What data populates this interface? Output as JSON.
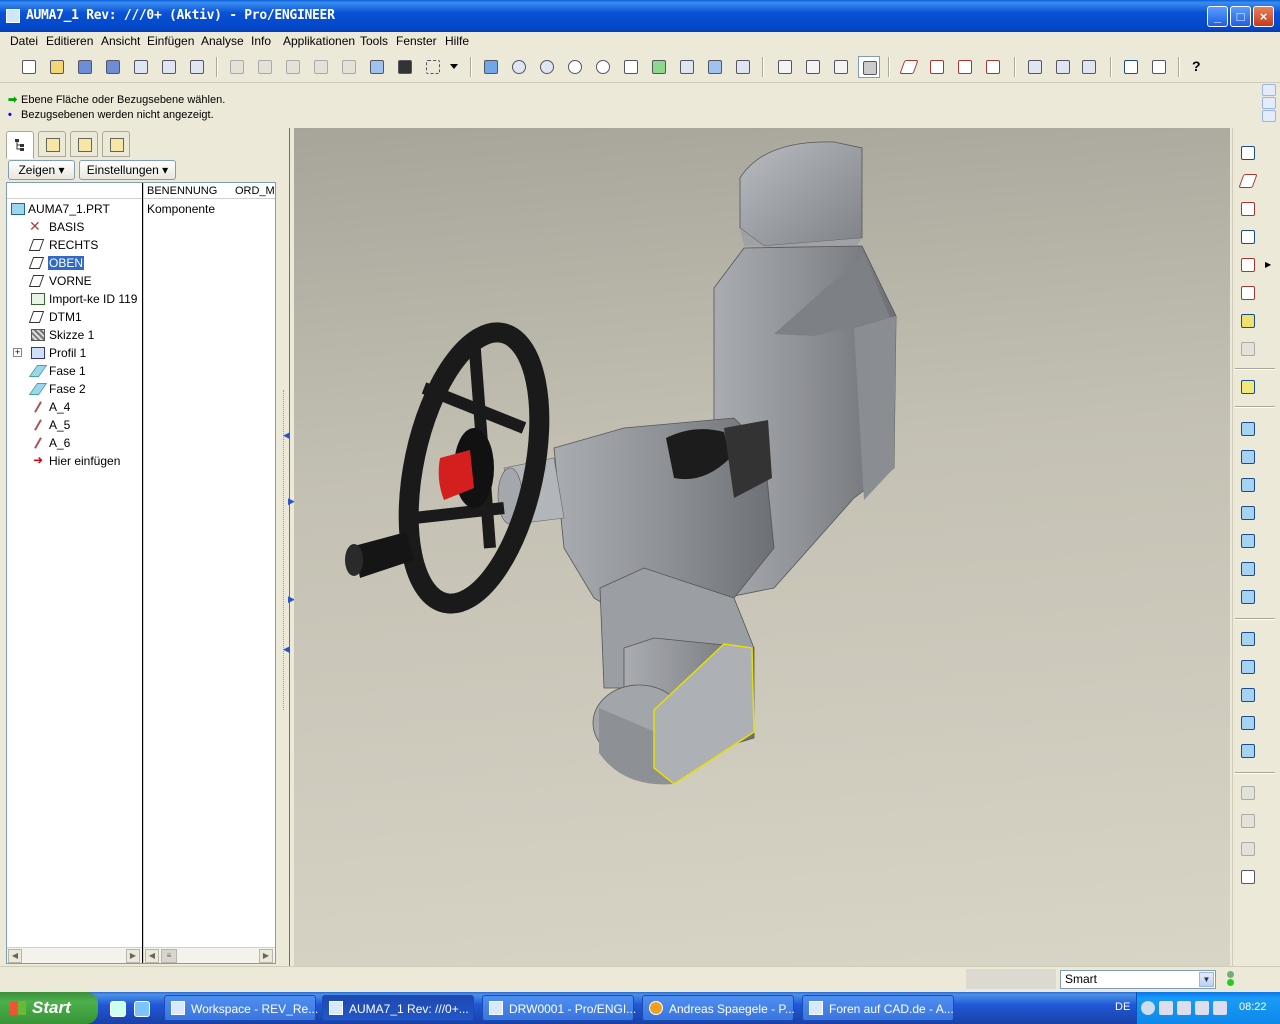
{
  "window": {
    "title": "AUMA7_1 Rev: ///0+ (Aktiv) - Pro/ENGINEER",
    "minimize_label": "_",
    "maximize_label": "□",
    "close_label": "×"
  },
  "menu": [
    "Datei",
    "Editieren",
    "Ansicht",
    "Einfügen",
    "Analyse",
    "Info",
    "Applikationen",
    "Tools",
    "Fenster",
    "Hilfe"
  ],
  "messages": [
    {
      "icon": "arrow-right-icon",
      "text": "Ebene Fläche oder Bezugsebene wählen."
    },
    {
      "icon": "info-dot-icon",
      "text": "Bezugsebenen werden nicht angezeigt."
    }
  ],
  "panel": {
    "show_button": "Zeigen",
    "settings_button": "Einstellungen",
    "columns": [
      "BENENNUNG",
      "ORD_M"
    ],
    "tree_items": [
      {
        "label": "AUMA7_1.PRT",
        "icon": "part-icon",
        "value": "Komponente"
      },
      {
        "label": "BASIS",
        "icon": "coordinate-system-icon"
      },
      {
        "label": "RECHTS",
        "icon": "datum-plane-icon"
      },
      {
        "label": "OBEN",
        "icon": "datum-plane-icon",
        "selected": true
      },
      {
        "label": "VORNE",
        "icon": "datum-plane-icon"
      },
      {
        "label": "Import-ke ID 119",
        "icon": "import-feature-icon"
      },
      {
        "label": "DTM1",
        "icon": "datum-plane-icon"
      },
      {
        "label": "Skizze 1",
        "icon": "sketch-icon"
      },
      {
        "label": "Profil 1",
        "icon": "profile-icon",
        "expandable": true
      },
      {
        "label": "Fase 1",
        "icon": "chamfer-icon"
      },
      {
        "label": "Fase 2",
        "icon": "chamfer-icon"
      },
      {
        "label": "A_4",
        "icon": "datum-axis-icon"
      },
      {
        "label": "A_5",
        "icon": "datum-axis-icon"
      },
      {
        "label": "A_6",
        "icon": "datum-axis-icon"
      },
      {
        "label": "Hier einfügen",
        "icon": "insert-here-icon"
      }
    ]
  },
  "status": {
    "filter_value": "Smart"
  },
  "taskbar": {
    "start_label": "Start",
    "tasks": [
      {
        "label": "Workspace - REV_Re...",
        "active": false
      },
      {
        "label": "AUMA7_1 Rev: ///0+...",
        "active": true
      },
      {
        "label": "DRW0001 - Pro/ENGI...",
        "active": false
      },
      {
        "label": "Andreas Spaegele - P...",
        "active": false
      },
      {
        "label": "Foren auf CAD.de - A...",
        "active": false
      }
    ],
    "language": "DE",
    "clock": "08:22"
  },
  "colors": {
    "titlebar": "#0a52d6",
    "viewport_bg": "#c4c1b4",
    "model_gray": "#8e9196",
    "handwheel": "#1a1a1a",
    "lever_red": "#d51f1f",
    "highlight_yellow": "#e8e000",
    "selection": "#316ac5"
  }
}
